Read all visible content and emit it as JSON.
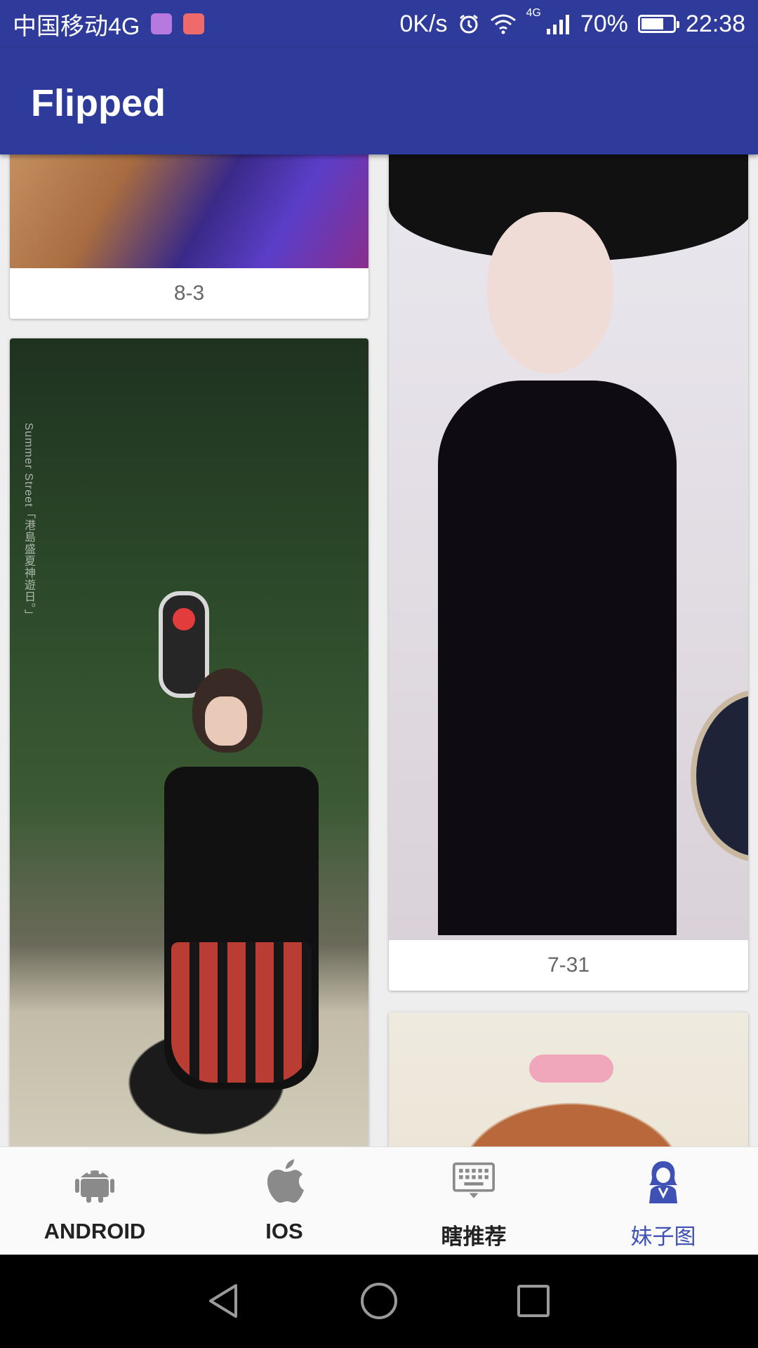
{
  "status_bar": {
    "carrier": "中国移动4G",
    "net_speed": "0K/s",
    "signal_type": "4G",
    "battery_percent": "70%",
    "battery_level": 0.7,
    "time": "22:38"
  },
  "app_bar": {
    "title": "Flipped"
  },
  "feed": {
    "cards": [
      {
        "caption": "8-3"
      },
      {
        "caption": "",
        "overlay_text": "Summer Street「港島盛夏神遊日。」"
      },
      {
        "caption": "7-31"
      },
      {
        "caption": ""
      }
    ]
  },
  "bottom_nav": {
    "items": [
      {
        "label": "ANDROID",
        "icon": "android-icon"
      },
      {
        "label": "IOS",
        "icon": "apple-icon"
      },
      {
        "label": "瞎推荐",
        "icon": "keyboard-icon"
      },
      {
        "label": "妹子图",
        "icon": "girl-icon"
      }
    ],
    "active_index": 3,
    "active_color": "#3f51b5",
    "inactive_color": "#757575"
  },
  "colors": {
    "primary": "#2f3b9a",
    "accent": "#3f51b5"
  }
}
